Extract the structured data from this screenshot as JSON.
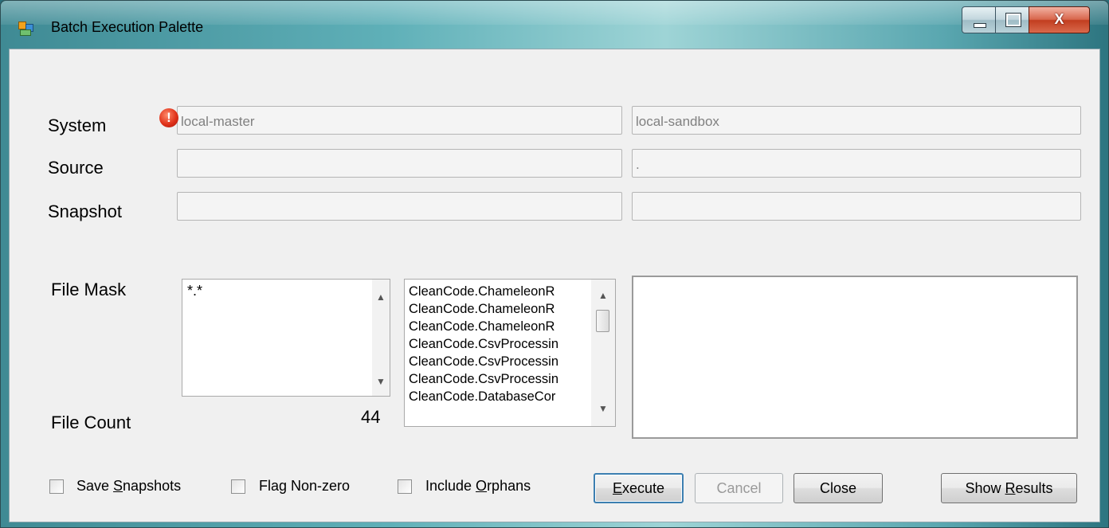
{
  "window": {
    "title": "Batch Execution Palette"
  },
  "titlebar": {
    "close_glyph": "X"
  },
  "labels": {
    "system": "System",
    "source": "Source",
    "snapshot": "Snapshot",
    "file_mask": "File Mask",
    "file_count": "File Count"
  },
  "fields": {
    "system_left": "local-master",
    "system_right": "local-sandbox",
    "source_left": "",
    "source_right": ".",
    "snapshot_left": "",
    "snapshot_right": ""
  },
  "error_icon_glyph": "!",
  "file_mask_value": "*.*",
  "file_count_value": "44",
  "file_list": [
    "CleanCode.ChameleonR",
    "CleanCode.ChameleonR",
    "CleanCode.ChameleonR",
    "CleanCode.CsvProcessin",
    "CleanCode.CsvProcessin",
    "CleanCode.CsvProcessin",
    "CleanCode.DatabaseCor"
  ],
  "checkboxes": {
    "save_snapshots": {
      "prefix": "Save ",
      "accel": "S",
      "suffix": "napshots"
    },
    "flag_nonzero": {
      "label": "Flag Non-zero"
    },
    "include_orphans": {
      "prefix": "Include ",
      "accel": "O",
      "suffix": "rphans"
    }
  },
  "buttons": {
    "execute": {
      "accel": "E",
      "suffix": "xecute"
    },
    "cancel": {
      "label": "Cancel"
    },
    "close": {
      "label": "Close"
    },
    "show_results": {
      "prefix": "Show ",
      "accel": "R",
      "suffix": "esults"
    }
  }
}
